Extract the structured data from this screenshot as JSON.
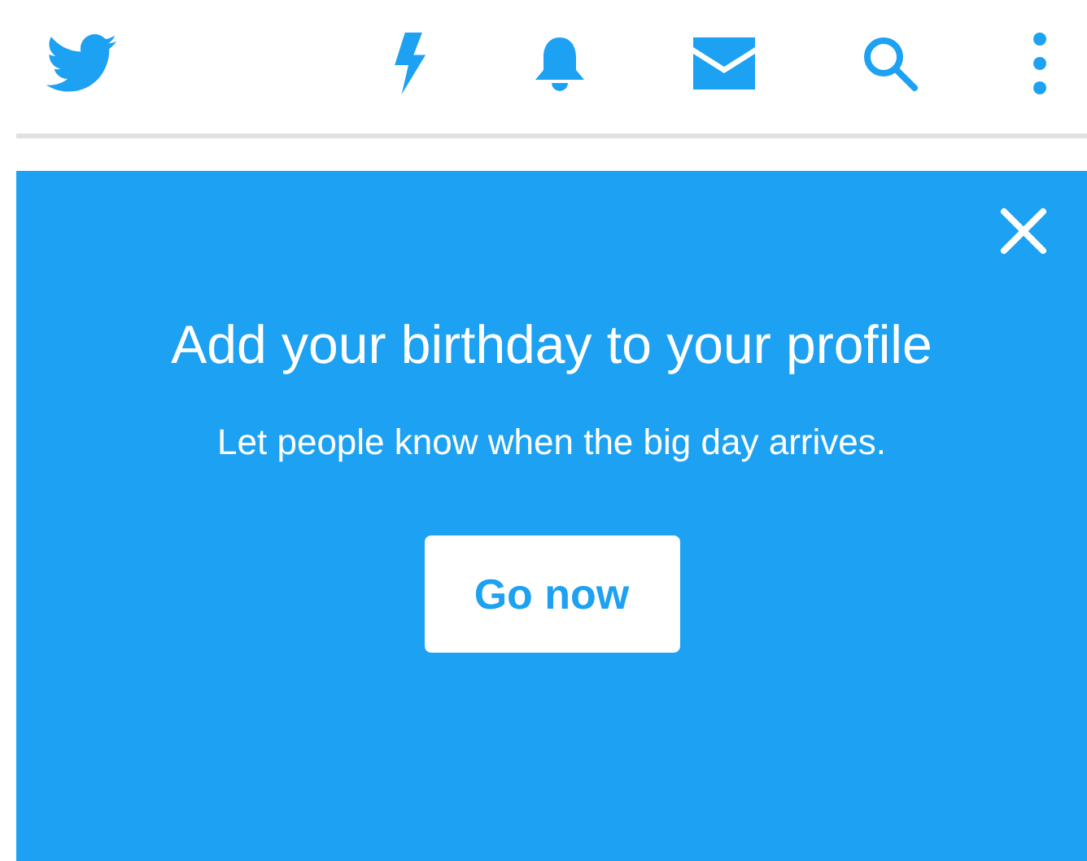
{
  "prompt_card": {
    "title": "Add your birthday to your profile",
    "subtitle": "Let people know when the big day arrives.",
    "button": "Go now"
  }
}
